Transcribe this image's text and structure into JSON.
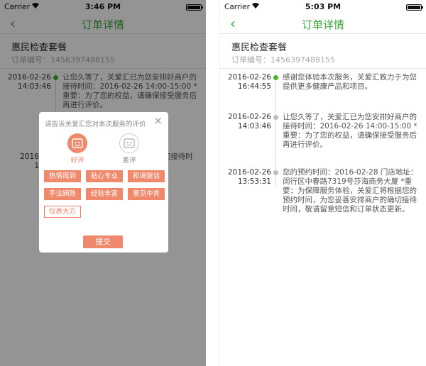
{
  "left": {
    "status_bar": {
      "carrier": "Carrier",
      "time": "3:46 PM"
    },
    "nav": {
      "back_icon": "‹",
      "title": "订单详情"
    },
    "order": {
      "package_name": "惠民检查套餐",
      "order_no": "订单编号：1456397488155"
    },
    "timeline": [
      {
        "date": "2016-02-26",
        "time": "14:03:46",
        "text": "让您久等了，关爱汇已为您安排好商户的接待时间：2016-02-26 14:00-15:00 *重要：为了您的权益，请确保接受服务后再进行评价。"
      },
      {
        "date": "2016-02",
        "time": "13:5",
        "text": "...莎海商务大 ...将根据您的 ...切接待时"
      }
    ],
    "modal": {
      "title": "请告诉关爱汇您对本次服务的评价",
      "close_icon": "×",
      "good_label": "好评",
      "bad_label": "差评",
      "tags": [
        "热情周到",
        "贴心专业",
        "和谒健谈",
        "手法娴熟",
        "经验丰富",
        "意见中肯",
        "仪表大方"
      ],
      "submit_label": "提交"
    }
  },
  "right": {
    "status_bar": {
      "carrier": "Carrier",
      "time": "5:03 PM"
    },
    "nav": {
      "back_icon": "‹",
      "title": "订单详情"
    },
    "order": {
      "package_name": "惠民检查套餐",
      "order_no": "订单编号：1456397488155"
    },
    "timeline": [
      {
        "date": "2016-02-26",
        "time": "16:44:55",
        "text": "感谢您体验本次服务，关爱汇致力于为您提供更多健康产品和项目。",
        "active": true
      },
      {
        "date": "2016-02-26",
        "time": "14:03:46",
        "text": "让您久等了，关爱汇已为您安排好商户的接待时间：2016-02-26 14:00-15:00 *重要：为了您的权益，请确保接受服务后再进行评价。",
        "active": false
      },
      {
        "date": "2016-02-26",
        "time": "13:53:31",
        "text": "您的预约时间：2016-02-28 门店地址：闵行区中春路7319号莎海商务大厦 *重要：为保障服务体验，关爱汇将根据您的预约时间，为您妥善安排商户的确切接待时间，敬请留意短信和订单状态更新。",
        "active": false
      }
    ]
  },
  "colors": {
    "accent_green": "#3aa63a",
    "dot_green": "#46b52c",
    "coral": "#f0886c"
  }
}
